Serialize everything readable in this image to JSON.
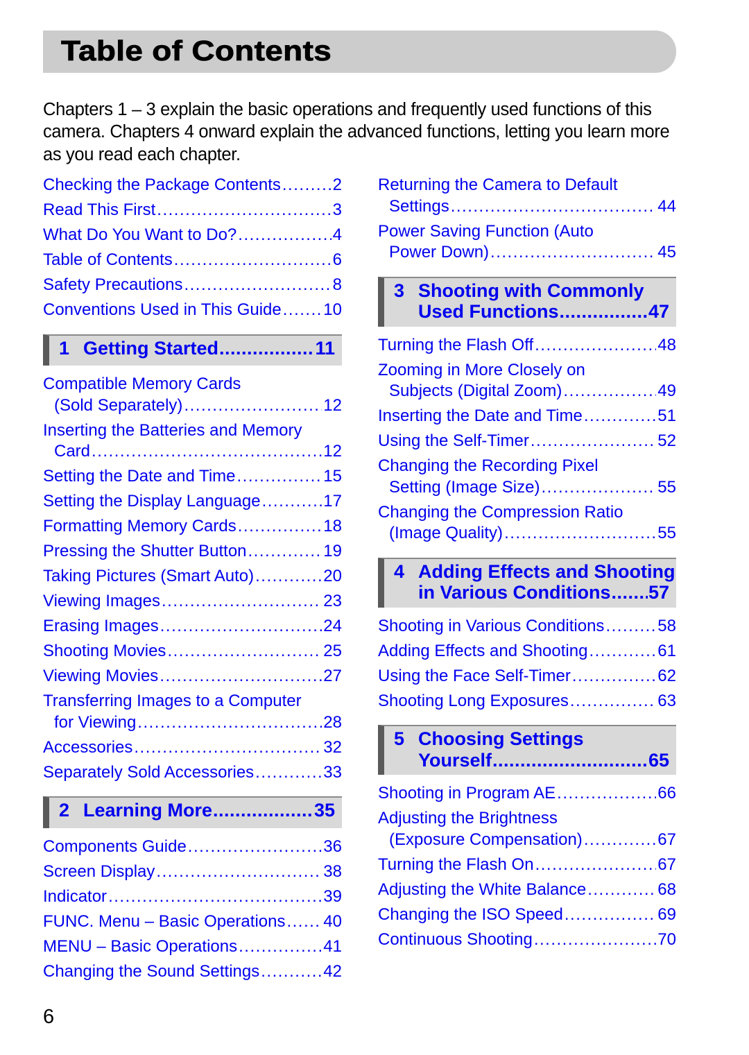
{
  "header": {
    "title": "Table of Contents"
  },
  "intro": "Chapters 1 – 3 explain the basic operations and frequently used functions of this camera. Chapters 4 onward explain the advanced functions, letting you learn more as you read each chapter.",
  "colors": {
    "link": "#0000ee",
    "title_bar": "#cccccc",
    "section_bg": "#d9d9d9",
    "section_bar": "#5a5a5a"
  },
  "left_column": {
    "front_matter": [
      {
        "lines": [
          "Checking the Package Contents"
        ],
        "page": "2"
      },
      {
        "lines": [
          "Read This First"
        ],
        "page": "3"
      },
      {
        "lines": [
          "What Do You Want to Do?"
        ],
        "page": "4"
      },
      {
        "lines": [
          "Table of Contents"
        ],
        "page": "6"
      },
      {
        "lines": [
          "Safety Precautions"
        ],
        "page": "8"
      },
      {
        "lines": [
          "Conventions Used in This Guide"
        ],
        "page": "10"
      }
    ],
    "chapter1": {
      "number": "1",
      "lines": [
        "Getting Started"
      ],
      "page": "11",
      "entries": [
        {
          "lines": [
            "Compatible Memory Cards",
            "(Sold Separately)"
          ],
          "page": "12"
        },
        {
          "lines": [
            "Inserting the Batteries and Memory",
            "Card"
          ],
          "page": "12"
        },
        {
          "lines": [
            "Setting the Date and Time"
          ],
          "page": "15"
        },
        {
          "lines": [
            "Setting the Display Language"
          ],
          "page": "17"
        },
        {
          "lines": [
            "Formatting Memory Cards"
          ],
          "page": "18"
        },
        {
          "lines": [
            "Pressing the Shutter Button"
          ],
          "page": "19"
        },
        {
          "lines": [
            "Taking Pictures (Smart Auto)"
          ],
          "page": "20"
        },
        {
          "lines": [
            "Viewing Images"
          ],
          "page": "23"
        },
        {
          "lines": [
            "Erasing Images"
          ],
          "page": "24"
        },
        {
          "lines": [
            "Shooting Movies"
          ],
          "page": "25"
        },
        {
          "lines": [
            "Viewing Movies"
          ],
          "page": "27"
        },
        {
          "lines": [
            "Transferring Images to a Computer",
            "for Viewing"
          ],
          "page": "28"
        },
        {
          "lines": [
            "Accessories"
          ],
          "page": "32"
        },
        {
          "lines": [
            "Separately Sold Accessories"
          ],
          "page": "33"
        }
      ]
    },
    "chapter2": {
      "number": "2",
      "lines": [
        "Learning More"
      ],
      "page": "35",
      "entries": [
        {
          "lines": [
            "Components Guide"
          ],
          "page": "36"
        },
        {
          "lines": [
            "Screen Display"
          ],
          "page": "38"
        },
        {
          "lines": [
            "Indicator"
          ],
          "page": "39"
        },
        {
          "lines": [
            "FUNC. Menu – Basic Operations"
          ],
          "page": "40"
        },
        {
          "lines": [
            "MENU – Basic Operations"
          ],
          "page": "41"
        },
        {
          "lines": [
            "Changing the Sound Settings"
          ],
          "page": "42"
        }
      ]
    }
  },
  "right_column": {
    "continued": [
      {
        "lines": [
          "Returning the Camera to Default",
          "Settings"
        ],
        "page": "44"
      },
      {
        "lines": [
          "Power Saving Function (Auto",
          "Power Down)"
        ],
        "page": "45"
      }
    ],
    "chapter3": {
      "number": "3",
      "lines": [
        "Shooting with Commonly",
        "Used Functions"
      ],
      "page": "47",
      "entries": [
        {
          "lines": [
            "Turning the Flash Off"
          ],
          "page": "48"
        },
        {
          "lines": [
            "Zooming in More Closely on",
            "Subjects (Digital Zoom)"
          ],
          "page": "49"
        },
        {
          "lines": [
            "Inserting the Date and Time"
          ],
          "page": "51"
        },
        {
          "lines": [
            "Using the Self-Timer"
          ],
          "page": "52"
        },
        {
          "lines": [
            "Changing the Recording Pixel",
            "Setting (Image Size)"
          ],
          "page": "55"
        },
        {
          "lines": [
            "Changing the Compression Ratio",
            "(Image Quality)"
          ],
          "page": "55"
        }
      ]
    },
    "chapter4": {
      "number": "4",
      "lines": [
        "Adding Effects and Shooting",
        "in Various Conditions"
      ],
      "page": "57",
      "entries": [
        {
          "lines": [
            "Shooting in Various Conditions"
          ],
          "page": "58"
        },
        {
          "lines": [
            "Adding Effects and Shooting"
          ],
          "page": "61"
        },
        {
          "lines": [
            "Using the Face Self-Timer"
          ],
          "page": "62"
        },
        {
          "lines": [
            "Shooting Long Exposures"
          ],
          "page": "63"
        }
      ]
    },
    "chapter5": {
      "number": "5",
      "lines": [
        "Choosing Settings",
        "Yourself"
      ],
      "page": "65",
      "entries": [
        {
          "lines": [
            "Shooting in Program AE"
          ],
          "page": "66"
        },
        {
          "lines": [
            "Adjusting the Brightness",
            "(Exposure Compensation)"
          ],
          "page": "67"
        },
        {
          "lines": [
            "Turning the Flash On"
          ],
          "page": "67"
        },
        {
          "lines": [
            "Adjusting the White Balance"
          ],
          "page": "68"
        },
        {
          "lines": [
            "Changing the ISO Speed"
          ],
          "page": "69"
        },
        {
          "lines": [
            "Continuous Shooting"
          ],
          "page": "70"
        }
      ]
    }
  },
  "footer": {
    "page_number": "6"
  }
}
